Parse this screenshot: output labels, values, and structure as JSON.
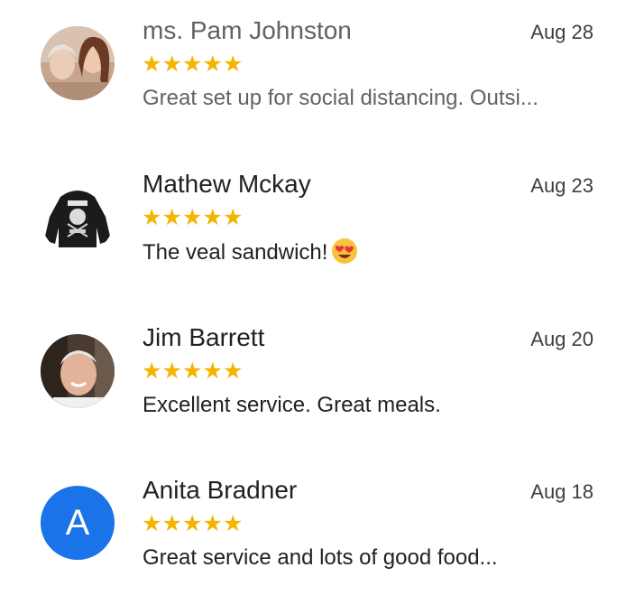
{
  "reviews": [
    {
      "name": "ms. Pam Johnston",
      "date": "Aug 28",
      "rating": 5,
      "stars": "★★★★★",
      "text": "Great set up for social distancing. Outsi...",
      "avatar": "photo"
    },
    {
      "name": "Mathew Mckay",
      "date": "Aug 23",
      "rating": 5,
      "stars": "★★★★★",
      "text": "The veal sandwich!",
      "emoji": "heart-eyes-emoji",
      "avatar": "photo"
    },
    {
      "name": "Jim Barrett",
      "date": "Aug 20",
      "rating": 5,
      "stars": "★★★★★",
      "text": "Excellent service. Great meals.",
      "avatar": "photo"
    },
    {
      "name": "Anita Bradner",
      "date": "Aug 18",
      "rating": 5,
      "stars": "★★★★★",
      "text": "Great service and lots of good food...",
      "avatar": "letter",
      "initial": "A"
    }
  ],
  "colors": {
    "star": "#f4b400",
    "avatar_letter_bg": "#1a73e8",
    "text": "#202124"
  }
}
